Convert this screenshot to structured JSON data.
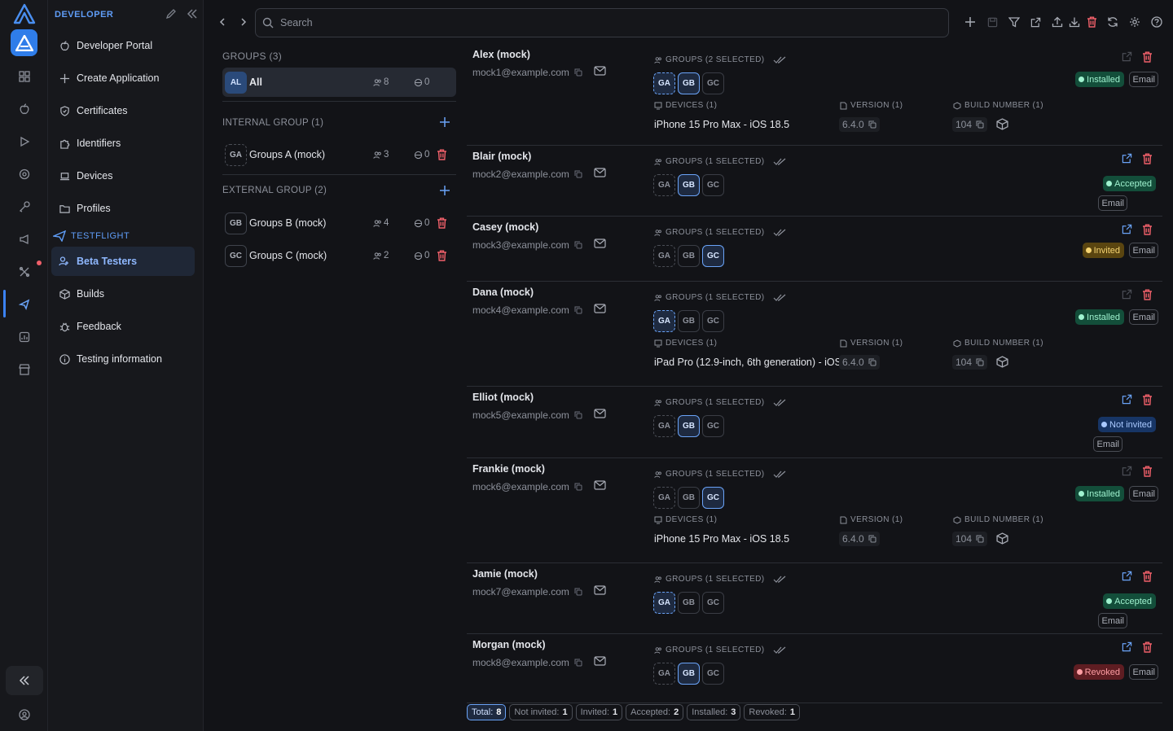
{
  "sidebar": {
    "section_label": "DEVELOPER",
    "items": [
      {
        "label": "Developer Portal",
        "icon": "apple-icon"
      },
      {
        "label": "Create Application",
        "icon": "plus-icon"
      },
      {
        "label": "Certificates",
        "icon": "shield-icon"
      },
      {
        "label": "Identifiers",
        "icon": "puzzle-icon"
      },
      {
        "label": "Devices",
        "icon": "laptop-icon"
      },
      {
        "label": "Profiles",
        "icon": "folder-icon"
      }
    ],
    "testflight_label": "TESTFLIGHT",
    "testflight_items": [
      {
        "label": "Beta Testers",
        "icon": "users-icon",
        "active": true
      },
      {
        "label": "Builds",
        "icon": "box-icon"
      },
      {
        "label": "Feedback",
        "icon": "bug-icon"
      },
      {
        "label": "Testing information",
        "icon": "info-icon"
      }
    ]
  },
  "search": {
    "placeholder": "Search"
  },
  "groups": {
    "title": "GROUPS (3)",
    "all": {
      "badge": "AL",
      "name": "All",
      "testers": "8",
      "devices": "0"
    },
    "internal_title": "INTERNAL GROUP (1)",
    "external_title": "EXTERNAL GROUP (2)",
    "internal": [
      {
        "badge": "GA",
        "name": "Groups A (mock)",
        "testers": "3",
        "devices": "0"
      }
    ],
    "external": [
      {
        "badge": "GB",
        "name": "Groups B (mock)",
        "testers": "4",
        "devices": "0"
      },
      {
        "badge": "GC",
        "name": "Groups C (mock)",
        "testers": "2",
        "devices": "0"
      }
    ]
  },
  "labels": {
    "devices": "DEVICES (1)",
    "version": "VERSION (1)",
    "build": "BUILD NUMBER (1)",
    "email_button": "Email"
  },
  "chip_labels": [
    "GA",
    "GB",
    "GC"
  ],
  "testers": [
    {
      "name": "Alex (mock)",
      "email": "mock1@example.com",
      "groups_label": "GROUPS (2 SELECTED)",
      "selected": [
        "GA",
        "GB"
      ],
      "status": "Installed",
      "device": "iPhone 15 Pro Max - iOS 18.5",
      "version": "6.4.0",
      "build": "104"
    },
    {
      "name": "Blair (mock)",
      "email": "mock2@example.com",
      "groups_label": "GROUPS (1 SELECTED)",
      "selected": [
        "GB"
      ],
      "status": "Accepted"
    },
    {
      "name": "Casey (mock)",
      "email": "mock3@example.com",
      "groups_label": "GROUPS (1 SELECTED)",
      "selected": [
        "GC"
      ],
      "status": "Invited"
    },
    {
      "name": "Dana (mock)",
      "email": "mock4@example.com",
      "groups_label": "GROUPS (1 SELECTED)",
      "selected": [
        "GA"
      ],
      "status": "Installed",
      "device": "iPad Pro (12.9-inch, 6th generation) - iOS",
      "version": "6.4.0",
      "build": "104"
    },
    {
      "name": "Elliot (mock)",
      "email": "mock5@example.com",
      "groups_label": "GROUPS (1 SELECTED)",
      "selected": [
        "GB"
      ],
      "status": "Not invited"
    },
    {
      "name": "Frankie (mock)",
      "email": "mock6@example.com",
      "groups_label": "GROUPS (1 SELECTED)",
      "selected": [
        "GC"
      ],
      "status": "Installed",
      "device": "iPhone 15 Pro Max - iOS 18.5",
      "version": "6.4.0",
      "build": "104"
    },
    {
      "name": "Jamie (mock)",
      "email": "mock7@example.com",
      "groups_label": "GROUPS (1 SELECTED)",
      "selected": [
        "GA"
      ],
      "status": "Accepted"
    },
    {
      "name": "Morgan (mock)",
      "email": "mock8@example.com",
      "groups_label": "GROUPS (1 SELECTED)",
      "selected": [
        "GB"
      ],
      "status": "Revoked"
    }
  ],
  "totals": [
    {
      "label": "Total:",
      "value": "8"
    },
    {
      "label": "Not invited:",
      "value": "1"
    },
    {
      "label": "Invited:",
      "value": "1"
    },
    {
      "label": "Accepted:",
      "value": "2"
    },
    {
      "label": "Installed:",
      "value": "3"
    },
    {
      "label": "Revoked:",
      "value": "1"
    }
  ],
  "colors": {
    "accent": "#3b82f6",
    "installed": "#134e3a",
    "invited": "#5a4510",
    "revoked": "#5e1d22",
    "not_invited": "#173565"
  }
}
